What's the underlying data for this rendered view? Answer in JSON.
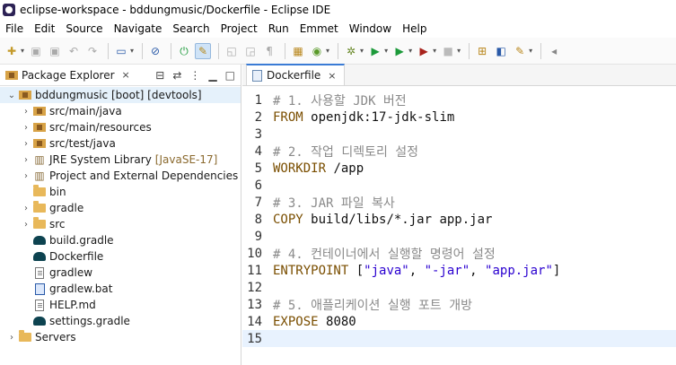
{
  "window": {
    "title": "eclipse-workspace - bddungmusic/Dockerfile - Eclipse IDE"
  },
  "menu": [
    "File",
    "Edit",
    "Source",
    "Navigate",
    "Search",
    "Project",
    "Run",
    "Emmet",
    "Window",
    "Help"
  ],
  "package_explorer": {
    "title": "Package Explorer",
    "close": "×",
    "items": [
      {
        "label": "bddungmusic [boot] [devtools]",
        "icon": "project-icon",
        "level": 0,
        "twisty": "open"
      },
      {
        "label": "src/main/java",
        "icon": "source-folder-icon",
        "level": 1,
        "twisty": "closed"
      },
      {
        "label": "src/main/resources",
        "icon": "source-folder-icon",
        "level": 1,
        "twisty": "closed"
      },
      {
        "label": "src/test/java",
        "icon": "source-folder-icon",
        "level": 1,
        "twisty": "closed"
      },
      {
        "label": "JRE System Library",
        "decoration": "[JavaSE-17]",
        "icon": "library-icon",
        "level": 1,
        "twisty": "closed"
      },
      {
        "label": "Project and External Dependencies",
        "icon": "library-icon",
        "level": 1,
        "twisty": "closed"
      },
      {
        "label": "bin",
        "icon": "folder-icon",
        "level": 1,
        "twisty": "none"
      },
      {
        "label": "gradle",
        "icon": "folder-icon",
        "level": 1,
        "twisty": "closed"
      },
      {
        "label": "src",
        "icon": "folder-icon",
        "level": 1,
        "twisty": "closed"
      },
      {
        "label": "build.gradle",
        "icon": "gradle-file-icon",
        "level": 1,
        "twisty": "none"
      },
      {
        "label": "Dockerfile",
        "icon": "gradle-file-icon",
        "level": 1,
        "twisty": "none"
      },
      {
        "label": "gradlew",
        "icon": "text-file-icon",
        "level": 1,
        "twisty": "none"
      },
      {
        "label": "gradlew.bat",
        "icon": "bat-file-icon",
        "level": 1,
        "twisty": "none"
      },
      {
        "label": "HELP.md",
        "icon": "text-file-icon",
        "level": 1,
        "twisty": "none"
      },
      {
        "label": "settings.gradle",
        "icon": "gradle-file-icon",
        "level": 1,
        "twisty": "none"
      },
      {
        "label": "Servers",
        "icon": "folder-icon",
        "level": 0,
        "twisty": "closed"
      }
    ]
  },
  "editor": {
    "tab_label": "Dockerfile",
    "close": "×",
    "current_line": 15,
    "lines": [
      {
        "n": "1",
        "parts": [
          {
            "t": "# 1. 사용할 JDK 버전",
            "k": "cmt"
          }
        ]
      },
      {
        "n": "2",
        "parts": [
          {
            "t": "FROM ",
            "k": "kw"
          },
          {
            "t": "openjdk:17-jdk-slim",
            "k": "txt"
          }
        ]
      },
      {
        "n": "3",
        "parts": []
      },
      {
        "n": "4",
        "parts": [
          {
            "t": "# 2. 작업 디렉토리 설정",
            "k": "cmt"
          }
        ]
      },
      {
        "n": "5",
        "parts": [
          {
            "t": "WORKDIR ",
            "k": "kw"
          },
          {
            "t": "/app",
            "k": "txt"
          }
        ]
      },
      {
        "n": "6",
        "parts": []
      },
      {
        "n": "7",
        "parts": [
          {
            "t": "# 3. JAR 파일 복사",
            "k": "cmt"
          }
        ]
      },
      {
        "n": "8",
        "parts": [
          {
            "t": "COPY ",
            "k": "kw"
          },
          {
            "t": "build/libs/*.jar app.jar",
            "k": "txt"
          }
        ]
      },
      {
        "n": "9",
        "parts": []
      },
      {
        "n": "10",
        "parts": [
          {
            "t": "# 4. 컨테이너에서 실행할 명령어 설정",
            "k": "cmt"
          }
        ]
      },
      {
        "n": "11",
        "parts": [
          {
            "t": "ENTRYPOINT ",
            "k": "kw"
          },
          {
            "t": "[",
            "k": "txt"
          },
          {
            "t": "\"java\"",
            "k": "str"
          },
          {
            "t": ", ",
            "k": "txt"
          },
          {
            "t": "\"-jar\"",
            "k": "str"
          },
          {
            "t": ", ",
            "k": "txt"
          },
          {
            "t": "\"app.jar\"",
            "k": "str"
          },
          {
            "t": "]",
            "k": "txt"
          }
        ]
      },
      {
        "n": "12",
        "parts": []
      },
      {
        "n": "13",
        "parts": [
          {
            "t": "# 5. 애플리케이션 실행 포트 개방",
            "k": "cmt"
          }
        ]
      },
      {
        "n": "14",
        "parts": [
          {
            "t": "EXPOSE ",
            "k": "kw"
          },
          {
            "t": "8080",
            "k": "txt"
          }
        ]
      },
      {
        "n": "15",
        "parts": []
      }
    ]
  },
  "colors": {
    "keyword": "#7a4e00",
    "comment": "#8a8a8a",
    "string": "#2a00d0",
    "current_line": "#e8f2fe",
    "selection": "#e5f1fb"
  }
}
